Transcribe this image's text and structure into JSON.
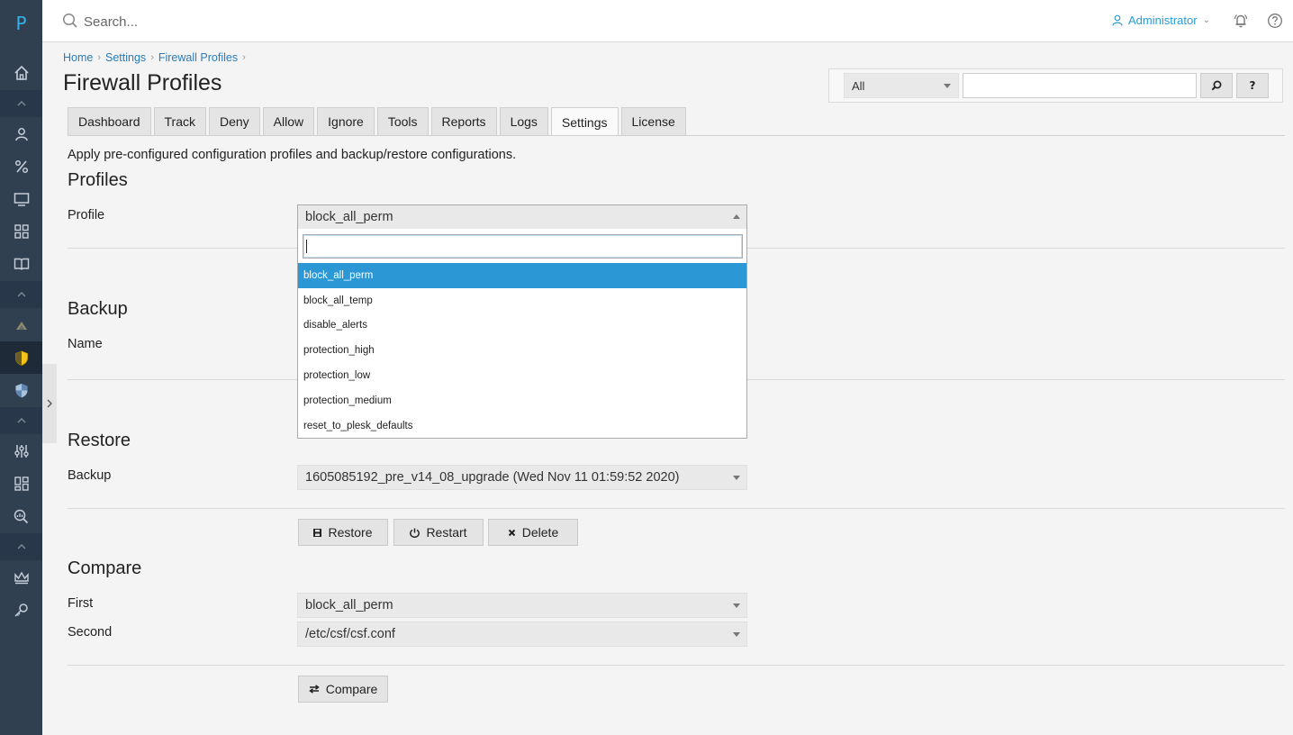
{
  "sidebar": {
    "logo": "P",
    "icons": [
      "home-icon",
      "users-icon",
      "percent-icon",
      "monitor-icon",
      "apps-icon",
      "book-icon",
      "extension-icon",
      "shield-icon",
      "firewall-icon",
      "sliders-icon",
      "dashboard-icon",
      "search-stats-icon",
      "crown-icon",
      "key-icon"
    ]
  },
  "topbar": {
    "search_placeholder": "Search...",
    "user": "Administrator"
  },
  "breadcrumb": [
    "Home",
    "Settings",
    "Firewall Profiles"
  ],
  "page_title": "Firewall Profiles",
  "filter": {
    "selected": "All",
    "search_button": "⌕",
    "help_button": "?"
  },
  "tabs": [
    "Dashboard",
    "Track",
    "Deny",
    "Allow",
    "Ignore",
    "Tools",
    "Reports",
    "Logs",
    "Settings",
    "License"
  ],
  "active_tab": "Settings",
  "description": "Apply pre-configured configuration profiles and backup/restore configurations.",
  "profiles": {
    "title": "Profiles",
    "label": "Profile",
    "selected": "block_all_perm",
    "options": [
      "block_all_perm",
      "block_all_temp",
      "disable_alerts",
      "protection_high",
      "protection_low",
      "protection_medium",
      "reset_to_plesk_defaults"
    ]
  },
  "backup": {
    "title": "Backup",
    "label": "Name"
  },
  "restore": {
    "title": "Restore",
    "label": "Backup",
    "selected": "1605085192_pre_v14_08_upgrade (Wed Nov 11 01:59:52 2020)",
    "restore_button": "Restore",
    "restart_button": "Restart",
    "delete_button": "Delete"
  },
  "compare": {
    "title": "Compare",
    "first_label": "First",
    "first_selected": "block_all_perm",
    "second_label": "Second",
    "second_selected": "/etc/csf/csf.conf",
    "compare_button": "Compare"
  }
}
